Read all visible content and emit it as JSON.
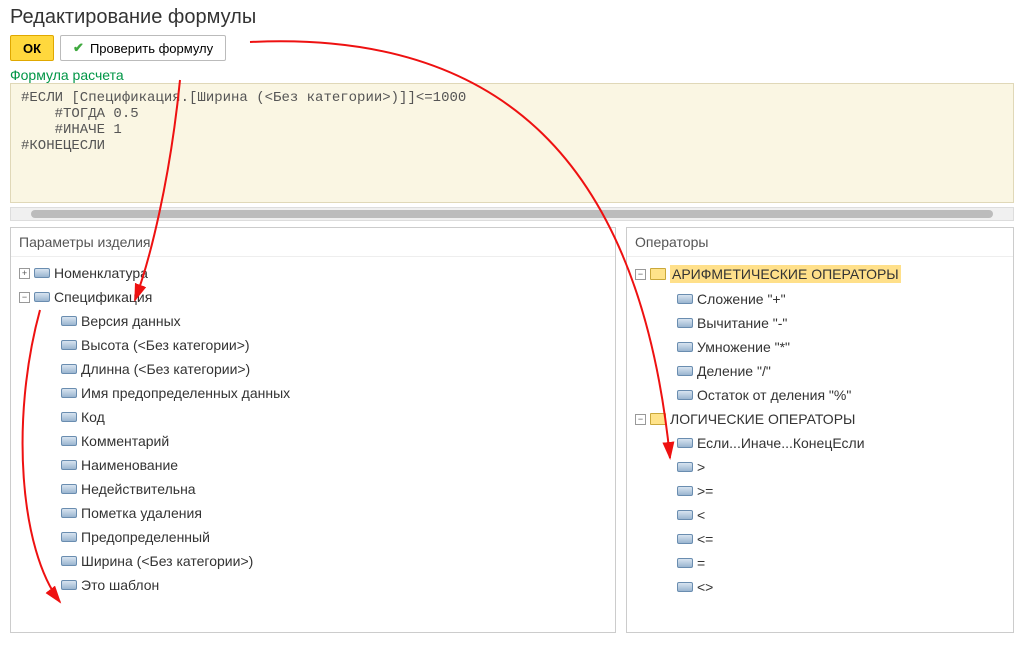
{
  "title": "Редактирование формулы",
  "toolbar": {
    "ok_label": "ОК",
    "check_label": "Проверить формулу"
  },
  "formula_header": "Формула расчета",
  "formula_lines": {
    "l1": "#ЕСЛИ [Спецификация.[Ширина (<Без категории>)]]<=1000",
    "l2": "    #ТОГДА 0.5",
    "l3": "    #ИНАЧЕ 1",
    "l4": "#КОНЕЦЕСЛИ"
  },
  "left_panel": {
    "title": "Параметры изделия",
    "root1": "Номенклатура",
    "root2": "Спецификация",
    "items": {
      "i0": "Версия данных",
      "i1": "Высота (<Без категории>)",
      "i2": "Длинна (<Без категории>)",
      "i3": "Имя предопределенных данных",
      "i4": "Код",
      "i5": "Комментарий",
      "i6": "Наименование",
      "i7": "Недействительна",
      "i8": "Пометка удаления",
      "i9": "Предопределенный",
      "i10": "Ширина (<Без категории>)",
      "i11": "Это шаблон"
    }
  },
  "right_panel": {
    "title": "Операторы",
    "group1": "АРИФМЕТИЧЕСКИЕ ОПЕРАТОРЫ",
    "g1items": {
      "a0": "Сложение \"+\"",
      "a1": "Вычитание \"-\"",
      "a2": "Умножение \"*\"",
      "a3": "Деление \"/\"",
      "a4": "Остаток от деления \"%\""
    },
    "group2": "ЛОГИЧЕСКИЕ ОПЕРАТОРЫ",
    "g2items": {
      "b0": "Если...Иначе...КонецЕсли",
      "b1": ">",
      "b2": ">=",
      "b3": "<",
      "b4": "<=",
      "b5": "=",
      "b6": "<>"
    }
  }
}
